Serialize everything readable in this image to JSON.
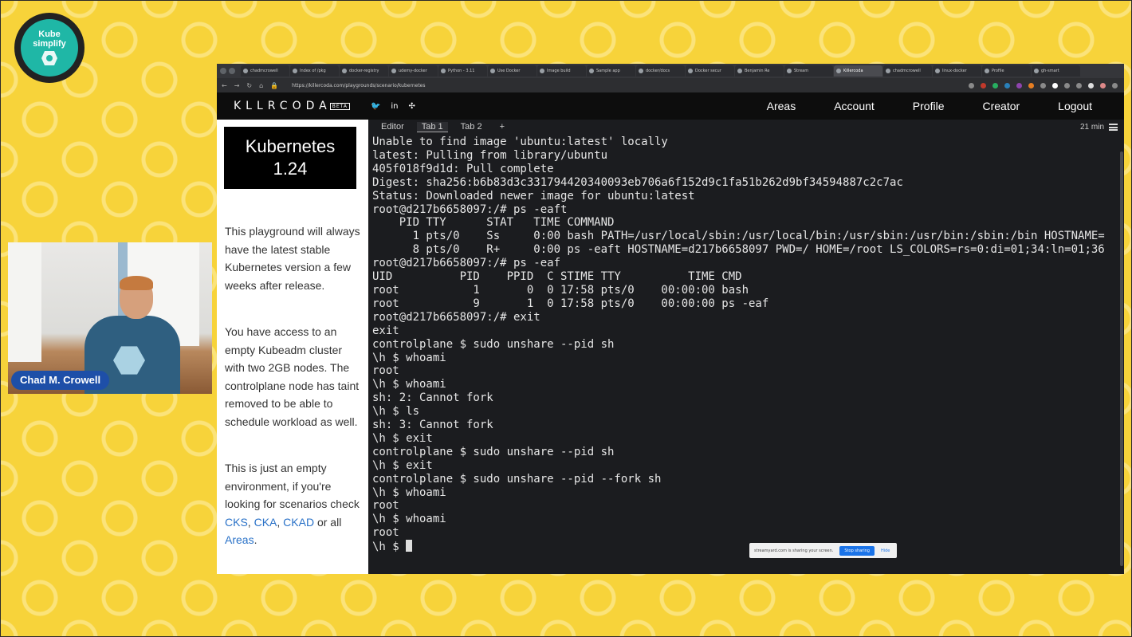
{
  "branding": {
    "logo_text_top": "Kube",
    "logo_text_bottom": "simplify"
  },
  "presenter": {
    "name": "Chad M. Crowell"
  },
  "browser": {
    "tabs": [
      "chadmcrowell",
      "Index of /pkg",
      "docker-registry",
      "udemy-docker",
      "Python - 3.11",
      "Use Docker",
      "Image build",
      "Sample app",
      "docker/docs",
      "Docker secur",
      "Benjamin Re",
      "Stream",
      "Killercoda",
      "chadmcrowell",
      "linux-docker",
      "Profile",
      "gh-smart"
    ],
    "active_tab_index": 12,
    "url": "https://killercoda.com/playgrounds/scenario/kubernetes"
  },
  "site": {
    "logo": "KLLRCODA",
    "beta": "BETA",
    "menu": [
      "Areas",
      "Account",
      "Profile",
      "Creator",
      "Logout"
    ]
  },
  "sidebar": {
    "title1": "Kubernetes",
    "title2": "1.24",
    "p1": "This playground will always have the latest stable Kubernetes version a few weeks after release.",
    "p2": "You have access to an empty Kubeadm cluster with two 2GB nodes. The controlplane node has taint removed to be able to schedule workload as well.",
    "p3_pre": "This is just an empty environment, if you're looking for scenarios check",
    "link_cks": "CKS",
    "link_cka": "CKA",
    "link_ckad": "CKAD",
    "p3_mid": "or all",
    "link_areas": "Areas",
    "p3_end": "."
  },
  "terminal": {
    "tabs": [
      "Editor",
      "Tab 1",
      "Tab 2",
      "+"
    ],
    "active_tab": "Tab 1",
    "time": "21 min",
    "lines": [
      "Unable to find image 'ubuntu:latest' locally",
      "latest: Pulling from library/ubuntu",
      "405f018f9d1d: Pull complete",
      "Digest: sha256:b6b83d3c331794420340093eb706a6f152d9c1fa51b262d9bf34594887c2c7ac",
      "Status: Downloaded newer image for ubuntu:latest",
      "root@d217b6658097:/# ps -eaft",
      "    PID TTY      STAT   TIME COMMAND",
      "      1 pts/0    Ss     0:00 bash PATH=/usr/local/sbin:/usr/local/bin:/usr/sbin:/usr/bin:/sbin:/bin HOSTNAME=",
      "      8 pts/0    R+     0:00 ps -eaft HOSTNAME=d217b6658097 PWD=/ HOME=/root LS_COLORS=rs=0:di=01;34:ln=01;36",
      "root@d217b6658097:/# ps -eaf",
      "UID          PID    PPID  C STIME TTY          TIME CMD",
      "root           1       0  0 17:58 pts/0    00:00:00 bash",
      "root           9       1  0 17:58 pts/0    00:00:00 ps -eaf",
      "root@d217b6658097:/# exit",
      "exit",
      "controlplane $ sudo unshare --pid sh",
      "\\h $ whoami",
      "root",
      "\\h $ whoami",
      "sh: 2: Cannot fork",
      "\\h $ ls",
      "sh: 3: Cannot fork",
      "\\h $ exit",
      "controlplane $ sudo unshare --pid sh",
      "\\h $ exit",
      "controlplane $ sudo unshare --pid --fork sh",
      "\\h $ whoami",
      "root",
      "\\h $ whoami",
      "root"
    ],
    "prompt": "\\h $ "
  },
  "share_bar": {
    "message": "streamyard.com is sharing your screen.",
    "stop": "Stop sharing",
    "hide": "Hide"
  }
}
